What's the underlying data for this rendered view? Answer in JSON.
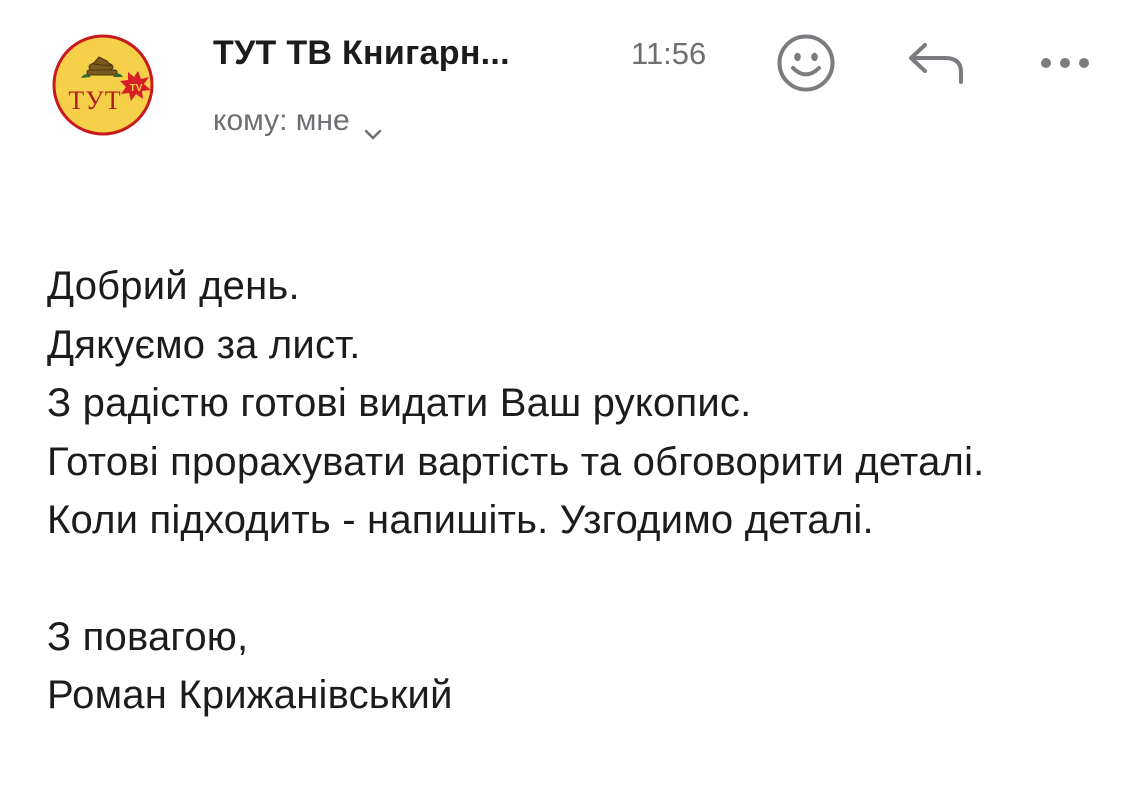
{
  "header": {
    "avatar": {
      "name": "tut-tv-logo",
      "text": "ТУТ",
      "badge": "TV"
    },
    "sender": "ТУТ ТВ Книгарн...",
    "time": "11:56",
    "recipient": "кому: мне",
    "actions": {
      "emoji": "smiley-icon",
      "reply": "reply-icon",
      "more": "more-icon"
    }
  },
  "message": {
    "lines": [
      "Добрий день.",
      "Дякуємо за лист.",
      "З радістю готові видати Ваш рукопис.",
      "Готові прорахувати вартість та обговорити деталі.",
      "Коли підходить - напишіть. Узгодимо деталі."
    ],
    "signature": [
      "З повагою,",
      "Роман Крижанівський"
    ]
  },
  "colors": {
    "logo_fill": "#f7d04a",
    "logo_ring": "#c8191f",
    "logo_text": "#b01b1f",
    "secondary_text": "#6e6e73",
    "icon_color": "#7c7c80"
  }
}
